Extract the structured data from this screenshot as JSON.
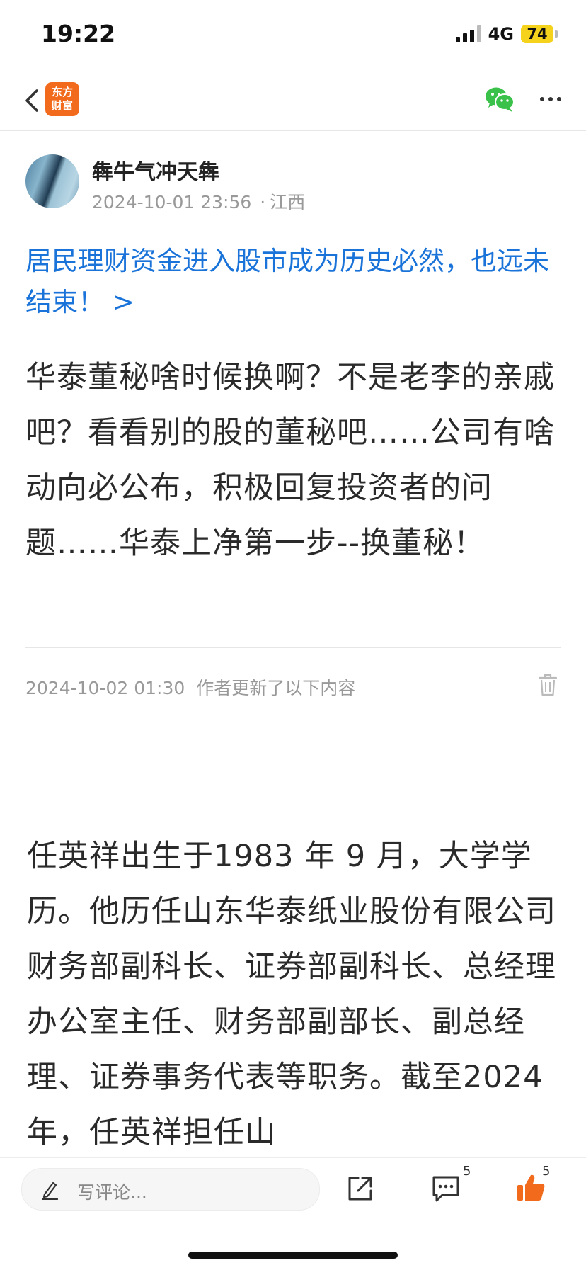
{
  "status_bar": {
    "time": "19:22",
    "network": "4G",
    "battery": "74"
  },
  "nav": {
    "logo_line1": "东方",
    "logo_line2": "财富",
    "icons": [
      "back-icon",
      "wechat-icon",
      "more-icon"
    ]
  },
  "author": {
    "name": "犇牛气冲天犇",
    "datetime": "2024-10-01 23:56",
    "location": "江西"
  },
  "topic_link": "居民理财资金进入股市成为历史必然，也远未结束！ >",
  "post_text": "华泰董秘啥时候换啊？不是老李的亲戚吧？看看别的股的董秘吧……公司有啥动向必公布，积极回复投资者的问题……华泰上净第一步--换董秘！",
  "update": {
    "datetime": "2024-10-02 01:30",
    "label": "作者更新了以下内容",
    "text": "任英祥出生于1983 年 9 月，大学学历。他历任山东华泰纸业股份有限公司财务部副科长、证券部副科长、总经理办公室主任、财务部副部长、副总经理、证券事务代表等职务。截至2024年，任英祥担任山"
  },
  "bottom_bar": {
    "comment_placeholder": "写评论...",
    "comment_count": "5",
    "like_count": "5"
  },
  "colors": {
    "link": "#1a73d9",
    "logo": "#f26a1b",
    "like": "#f26a1b",
    "battery": "#f5d31c"
  }
}
